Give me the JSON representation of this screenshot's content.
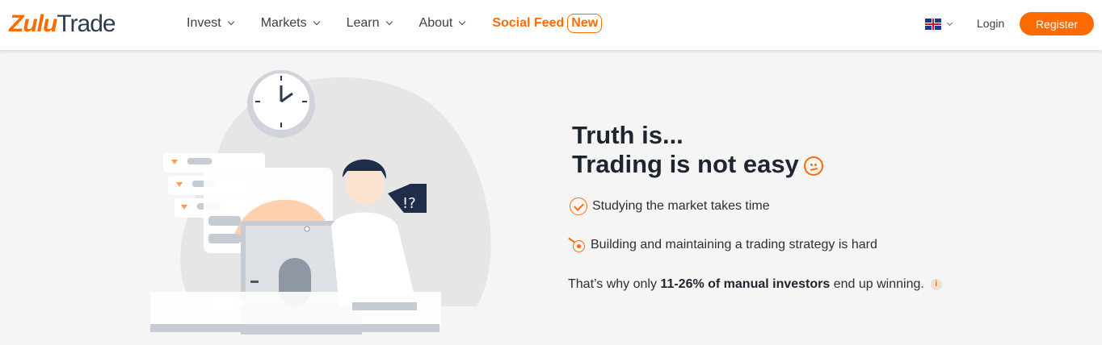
{
  "brand": {
    "part1": "Zulu",
    "part2": "Trade"
  },
  "nav": [
    {
      "label": "Invest"
    },
    {
      "label": "Markets"
    },
    {
      "label": "Learn"
    },
    {
      "label": "About"
    }
  ],
  "social": {
    "label": "Social Feed",
    "badge": "New"
  },
  "header": {
    "login": "Login",
    "register": "Register"
  },
  "hero": {
    "title_line1": "Truth is...",
    "title_line2": "Trading is not easy",
    "points": [
      "Studying the market takes time",
      "Building and maintaining a trading strategy is hard"
    ],
    "why_prefix": "That’s why only ",
    "why_bold": "11-26% of manual investors",
    "why_suffix": " end up winning.",
    "info_glyph": "i"
  },
  "colors": {
    "accent": "#ff6b00",
    "text": "#1f2530"
  }
}
